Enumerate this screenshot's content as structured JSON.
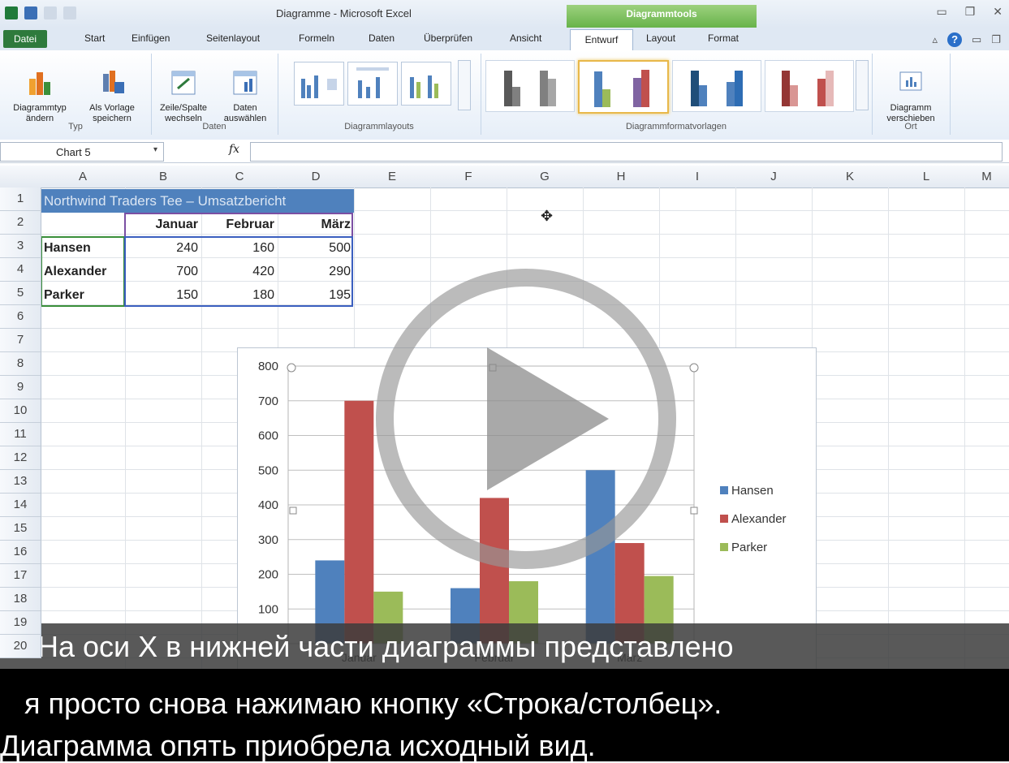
{
  "window": {
    "title": "Diagramme - Microsoft Excel",
    "context_tab": "Diagrammtools"
  },
  "tabs": [
    "Datei",
    "Start",
    "Einfügen",
    "Seitenlayout",
    "Formeln",
    "Daten",
    "Überprüfen",
    "Ansicht",
    "Entwurf",
    "Layout",
    "Format"
  ],
  "ribbon": {
    "groups": {
      "typ": {
        "label": "Typ",
        "change_type": "Diagrammtyp\nändern",
        "save_template": "Als Vorlage\nspeichern"
      },
      "daten": {
        "label": "Daten",
        "switch_row_col": "Zeile/Spalte\nwechseln",
        "select_data": "Daten\nauswählen"
      },
      "layouts": {
        "label": "Diagrammlayouts"
      },
      "styles": {
        "label": "Diagrammformatvorlagen"
      },
      "ort": {
        "label": "Ort",
        "move_chart": "Diagramm\nverschieben"
      }
    }
  },
  "formula_bar": {
    "name_box": "Chart 5",
    "fx": "fx",
    "value": ""
  },
  "columns": [
    "A",
    "B",
    "C",
    "D",
    "E",
    "F",
    "G",
    "H",
    "I",
    "J",
    "K",
    "L",
    "M"
  ],
  "rows": [
    "1",
    "2",
    "3",
    "4",
    "5",
    "6",
    "7",
    "8",
    "9",
    "10",
    "11",
    "12",
    "13",
    "14",
    "15",
    "16",
    "17",
    "18",
    "19",
    "20"
  ],
  "sheet": {
    "title": "Northwind Traders Tee – Umsatzbericht",
    "headers": [
      "Januar",
      "Februar",
      "März"
    ],
    "data": [
      {
        "name": "Hansen",
        "values": [
          "240",
          "160",
          "500"
        ]
      },
      {
        "name": "Alexander",
        "values": [
          "700",
          "420",
          "290"
        ]
      },
      {
        "name": "Parker",
        "values": [
          "150",
          "180",
          "195"
        ]
      }
    ]
  },
  "chart_data": {
    "type": "bar",
    "categories": [
      "Januar",
      "Februar",
      "März"
    ],
    "series": [
      {
        "name": "Hansen",
        "values": [
          240,
          160,
          500
        ],
        "color": "#4f81bd"
      },
      {
        "name": "Alexander",
        "values": [
          700,
          420,
          290
        ],
        "color": "#c0504d"
      },
      {
        "name": "Parker",
        "values": [
          150,
          180,
          195
        ],
        "color": "#9bbb59"
      }
    ],
    "ylim": [
      0,
      800
    ],
    "yticks": [
      "800",
      "700",
      "600",
      "500",
      "400",
      "300",
      "200",
      "100"
    ],
    "legend": "right",
    "grid": true
  },
  "subtitles": {
    "line1": "На оси X в нижней части диаграммы представлено",
    "line2": "я просто снова нажимаю кнопку «Строка/столбец».",
    "line3": "Диаграмма опять приобрела исходный вид."
  },
  "colors": {
    "excel_green": "#2e7a3c",
    "header_blue": "#4f81bd",
    "selection": "#e8b84a"
  }
}
